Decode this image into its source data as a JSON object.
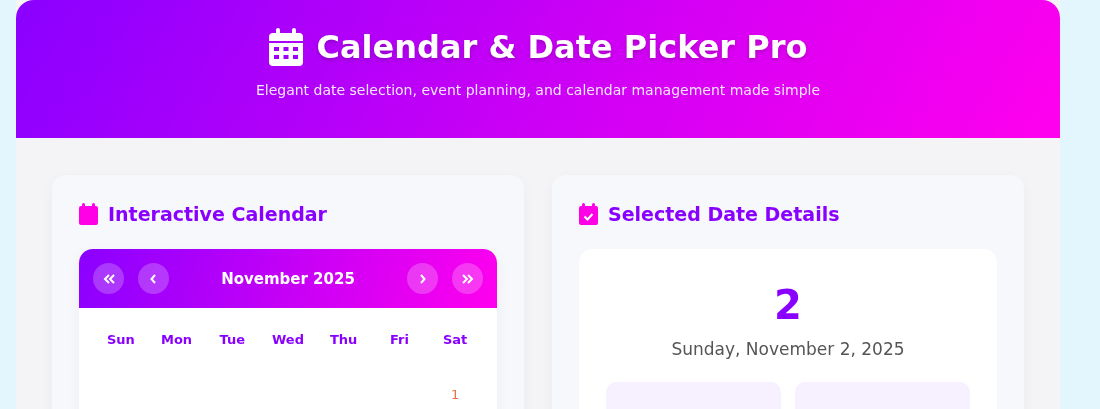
{
  "header": {
    "title": "Calendar & Date Picker Pro",
    "subtitle": "Elegant date selection, event planning, and calendar management made simple"
  },
  "calendar_panel": {
    "title": "Interactive Calendar",
    "month": "November 2025",
    "weekdays": [
      "Sun",
      "Mon",
      "Tue",
      "Wed",
      "Thu",
      "Fri",
      "Sat"
    ],
    "days": [
      {
        "label": "1",
        "weekend": true
      }
    ]
  },
  "details_panel": {
    "title": "Selected Date Details",
    "day": "2",
    "date": "Sunday, November 2, 2025"
  }
}
